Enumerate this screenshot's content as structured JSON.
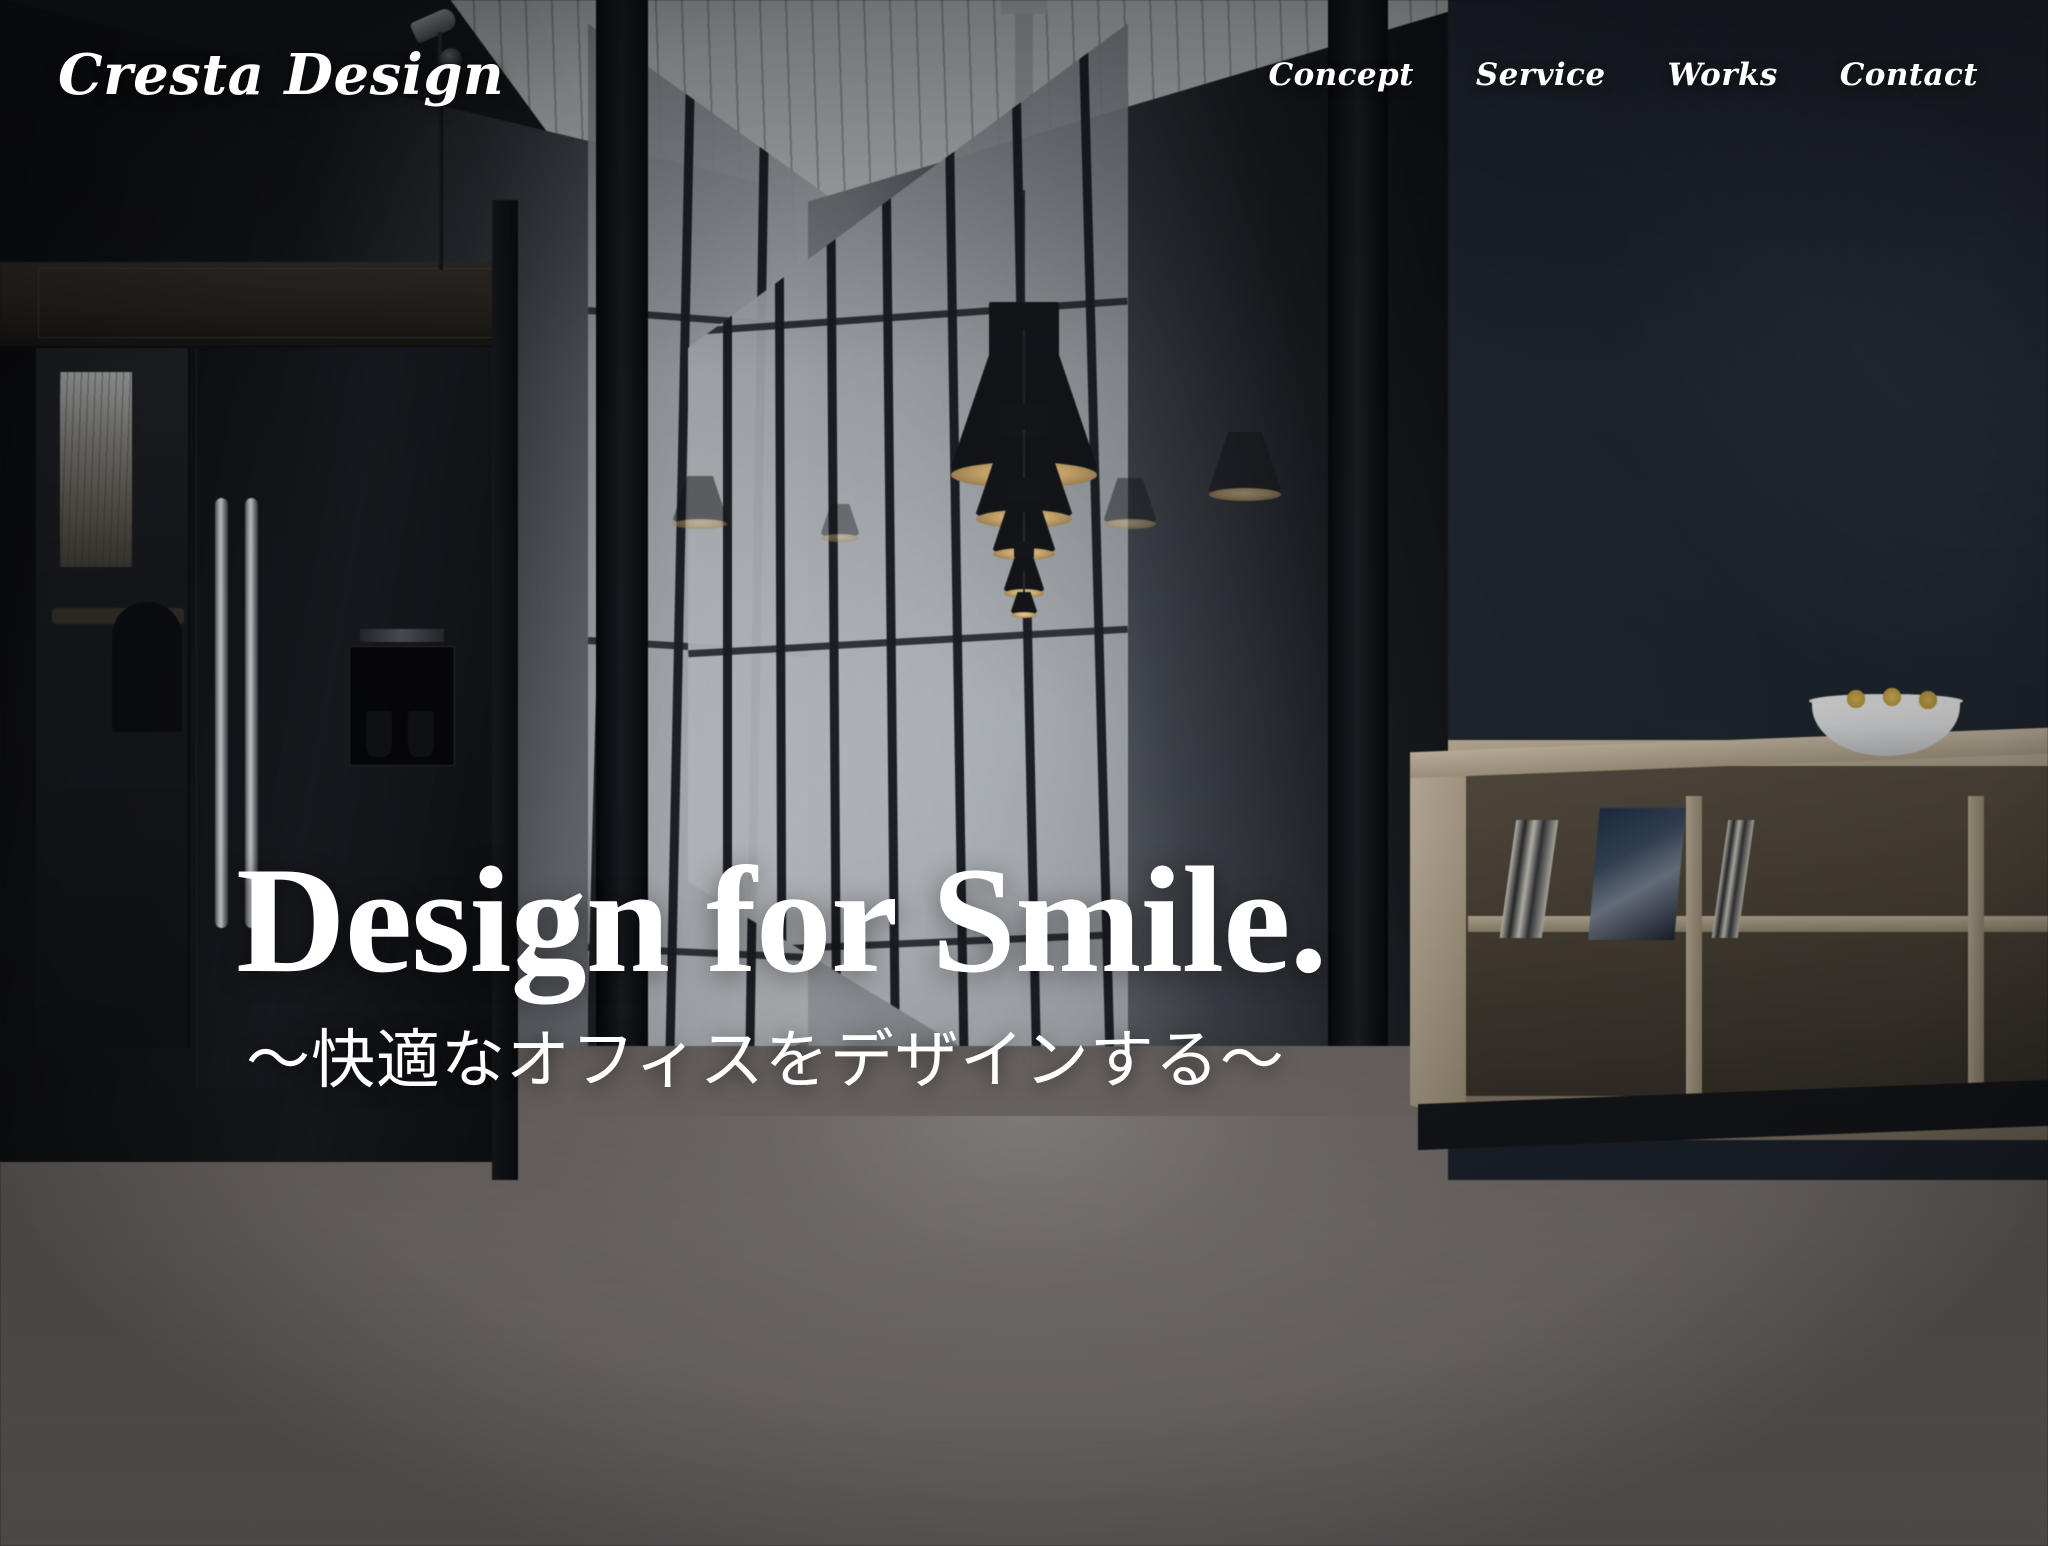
{
  "site": {
    "brand": "Cresta Design"
  },
  "header": {
    "logo_text": "Cresta Design",
    "nav": [
      {
        "label": "Concept"
      },
      {
        "label": "Service"
      },
      {
        "label": "Works"
      },
      {
        "label": "Contact"
      }
    ]
  },
  "hero": {
    "title": "Design for Smile.",
    "subtitle": "〜快適なオフィスをデザインする〜",
    "background_description": "Blurred photo of a modern office corridor with black-framed glass partition walls, black industrial pendant lamps, a dark pantry with a stainless steel refrigerator on the left, and a navy wall with a wooden credenza and white fruit bowl on the right."
  },
  "colors": {
    "text_on_hero": "#ffffff",
    "navy_wall": "#232b35",
    "floor": "#8d8581",
    "dark_frame": "#0b0c0f",
    "wood": "#b6a88f",
    "lamp_glow": "#ffe6ad"
  }
}
